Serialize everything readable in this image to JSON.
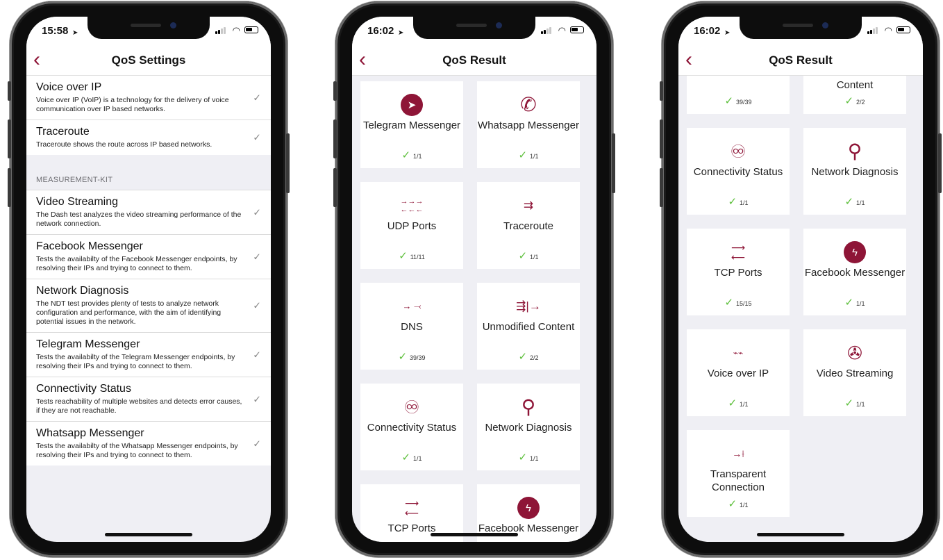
{
  "phones": [
    {
      "status": {
        "time": "15:58"
      },
      "nav": {
        "title": "QoS Settings",
        "back": "‹"
      },
      "rows_top": [
        {
          "title": "Voice over IP",
          "desc": "Voice over IP (VoIP) is a technology for the delivery of voice communication over IP based networks."
        },
        {
          "title": "Traceroute",
          "desc": "Traceroute shows the route across IP based networks."
        }
      ],
      "section": "MEASUREMENT-KIT",
      "rows": [
        {
          "title": "Video Streaming",
          "desc": "The Dash test analyzes the video streaming performance of the network connection."
        },
        {
          "title": "Facebook Messenger",
          "desc": "Tests the availabilty of the Facebook Messenger endpoints, by resolving their IPs and trying to connect to them."
        },
        {
          "title": "Network Diagnosis",
          "desc": "The NDT test provides plenty of tests to analyze network configuration and performance, with the aim of identifying potential issues in the network."
        },
        {
          "title": "Telegram Messenger",
          "desc": "Tests the availabilty of the Telegram Messenger endpoints, by resolving their IPs and trying to connect to them."
        },
        {
          "title": "Connectivity Status",
          "desc": "Tests reachability of multiple websites and detects error causes, if they are not reachable."
        },
        {
          "title": "Whatsapp Messenger",
          "desc": "Tests the availabilty of the Whatsapp Messenger endpoints, by resolving their IPs and trying to connect to them."
        }
      ],
      "check": "✓"
    },
    {
      "status": {
        "time": "16:02"
      },
      "nav": {
        "title": "QoS Result",
        "back": "‹"
      },
      "tiles": [
        {
          "name": "Telegram Messenger",
          "result": "1/1",
          "icon": "telegram-icon",
          "glyph": "➤"
        },
        {
          "name": "Whatsapp Messenger",
          "result": "1/1",
          "icon": "whatsapp-icon",
          "glyph": "✆"
        },
        {
          "name": "UDP Ports",
          "result": "11/11",
          "icon": "udp-ports-icon",
          "glyph": "→→→\n←←←"
        },
        {
          "name": "Traceroute",
          "result": "1/1",
          "icon": "traceroute-icon",
          "glyph": "⇉"
        },
        {
          "name": "DNS",
          "result": "39/39",
          "icon": "dns-icon",
          "glyph": "→ ⤙"
        },
        {
          "name": "Unmodified Content",
          "result": "2/2",
          "icon": "unmodified-content-icon",
          "glyph": "⇶|→"
        },
        {
          "name": "Connectivity Status",
          "result": "1/1",
          "icon": "connectivity-icon",
          "glyph": "♾"
        },
        {
          "name": "Network Diagnosis",
          "result": "1/1",
          "icon": "magnifier-icon",
          "glyph": "⚲"
        },
        {
          "name": "TCP Ports",
          "result": "",
          "icon": "tcp-ports-icon",
          "glyph": "⟶\n⟵"
        },
        {
          "name": "Facebook Messenger",
          "result": "",
          "icon": "messenger-icon",
          "glyph": "ϟ"
        }
      ]
    },
    {
      "status": {
        "time": "16:02"
      },
      "nav": {
        "title": "QoS Result",
        "back": "‹"
      },
      "tiles": [
        {
          "name": "",
          "result": "39/39",
          "icon": "dns-icon",
          "glyph": ""
        },
        {
          "name": "Content",
          "result": "2/2",
          "icon": "unmodified-content-icon",
          "glyph": ""
        },
        {
          "name": "Connectivity Status",
          "result": "1/1",
          "icon": "connectivity-icon",
          "glyph": "♾"
        },
        {
          "name": "Network Diagnosis",
          "result": "1/1",
          "icon": "magnifier-icon",
          "glyph": "⚲"
        },
        {
          "name": "TCP Ports",
          "result": "15/15",
          "icon": "tcp-ports-icon",
          "glyph": "⟶\n⟵"
        },
        {
          "name": "Facebook Messenger",
          "result": "1/1",
          "icon": "messenger-icon",
          "glyph": "ϟ"
        },
        {
          "name": "Voice over IP",
          "result": "1/1",
          "icon": "voip-icon",
          "glyph": "⌁⌁"
        },
        {
          "name": "Video Streaming",
          "result": "1/1",
          "icon": "film-reel-icon",
          "glyph": "✇"
        },
        {
          "name": "Transparent Connection",
          "result": "1/1",
          "icon": "transparent-connection-icon",
          "glyph": "→⟊"
        }
      ]
    }
  ],
  "colors": {
    "accent": "#8e1537",
    "success": "#5cbf3a",
    "background": "#efeff4"
  }
}
